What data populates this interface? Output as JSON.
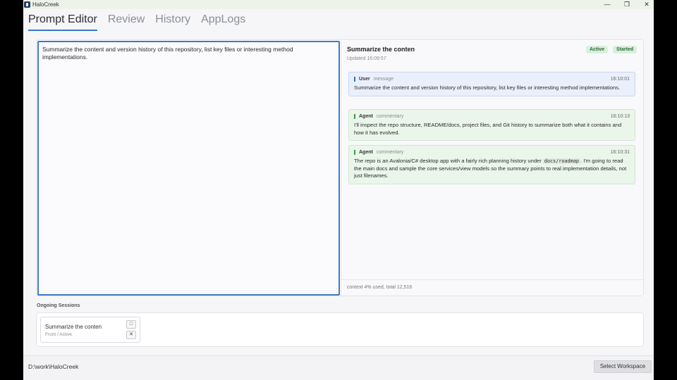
{
  "window": {
    "title": "HaloCreek",
    "controls": {
      "minimize": "—",
      "restore": "❐",
      "close": "✕"
    }
  },
  "tabs": [
    {
      "label": "Prompt Editor",
      "active": true
    },
    {
      "label": "Review",
      "active": false
    },
    {
      "label": "History",
      "active": false
    },
    {
      "label": "AppLogs",
      "active": false
    }
  ],
  "editor": {
    "text": "Summarize the content and version history of this repository, list key files or interesting method implementations."
  },
  "conversation": {
    "title": "Summarize the conten",
    "updated": "Updated 16:09:57",
    "badges": [
      "Active",
      "Started"
    ],
    "messages": [
      {
        "role": "User",
        "type": "message",
        "time": "16:10:01",
        "text": "Summarize the content and version history of this repository, list key files or interesting method implementations."
      },
      {
        "role": "Agent",
        "type": "commentary",
        "time": "16:10:13",
        "text": "I'll inspect the repo structure, README/docs, project files, and Git history to summarize both what it contains and how it has evolved."
      },
      {
        "role": "Agent",
        "type": "commentary",
        "time": "16:10:31",
        "text_before": "The repo is an Avalonia/C# desktop app with a fairly rich planning history under ",
        "code": "docs/roadmap",
        "text_after": ". I'm going to read the main docs and sample the core services/view models so the summary points to real implementation details, not just filenames."
      }
    ],
    "footer": "context 4% used, total 12,516"
  },
  "sessions": {
    "label": "Ongoing Sessions",
    "items": [
      {
        "title": "Summarize the conten",
        "subtitle": "Front / Active",
        "open_icon": "□",
        "close_icon": "✕"
      }
    ]
  },
  "statusbar": {
    "workspace_path": "D:\\work\\HaloCreek",
    "select_label": "Select Workspace"
  },
  "colors": {
    "accent": "#3b7bc8",
    "badge_bg": "#dbeedd",
    "user_msg_bg": "#eaf0fb",
    "agent_msg_bg": "#eaf6ea"
  }
}
